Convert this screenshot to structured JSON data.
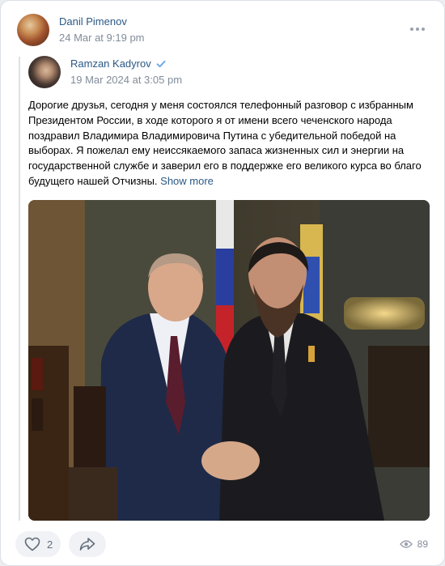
{
  "repost": {
    "author_name": "Danil Pimenov",
    "date": "24 Mar at 9:19 pm",
    "more_icon": "more-horizontal-icon"
  },
  "original": {
    "author_name": "Ramzan Kadyrov",
    "verified_icon": "verified-check-icon",
    "date": "19 Mar 2024 at 3:05 pm",
    "text": "Дорогие друзья, сегодня у меня состоялся телефонный разговор с избранным Президентом России, в ходе которого я от имени всего чеченского народа поздравил Владимира Владимировича Путина с убедительной победой на выборах. Я пожелал ему неиссякаемого запаса жизненных сил и энергии на государственной службе и заверил его в поддержке его великого курса во благо будущего нашей Отчизны.",
    "show_more": "Show more"
  },
  "footer": {
    "like_icon": "heart-icon",
    "likes": "2",
    "share_icon": "share-arrow-icon",
    "views_icon": "eye-icon",
    "views": "89"
  },
  "colors": {
    "link": "#2a5885",
    "muted": "#818c99",
    "verified": "#71aaeb",
    "button_bg": "#f0f2f5"
  }
}
